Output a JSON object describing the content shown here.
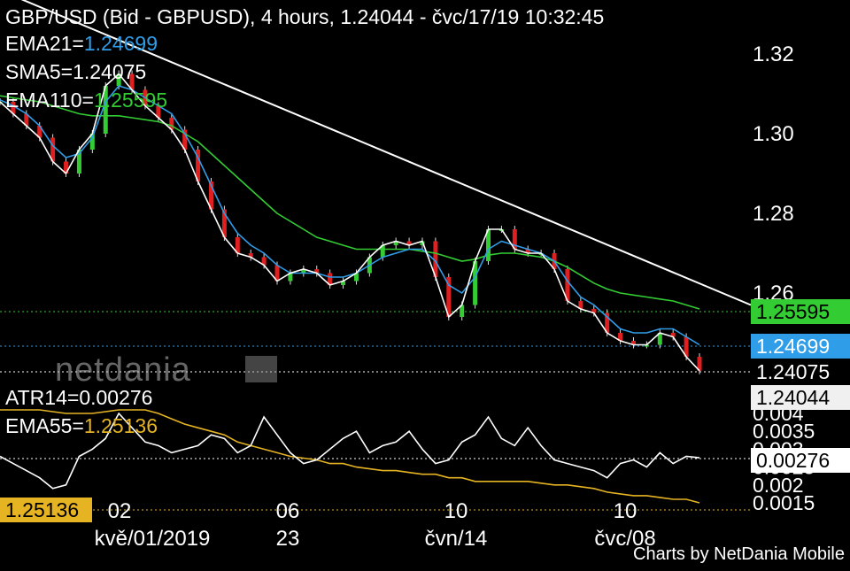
{
  "header": {
    "title": "GBP/USD (Bid - GBPUSD),  4 hours, 1.24044 - čvc/17/19 10:32:45",
    "ema21_label": "EMA21=",
    "ema21_value": "1.24699",
    "sma5_label": "SMA5=",
    "sma5_value": "1.24075",
    "ema110_label": "EMA110=",
    "ema110_value": "1.25595"
  },
  "lower_header": {
    "atr_label": "ATR14=",
    "atr_value": "0.00276",
    "ema55_label": "EMA55=",
    "ema55_value": "1.25136"
  },
  "price_tags": {
    "ema110": "1.25595",
    "ema21": "1.24699",
    "sma5": "1.24075",
    "last": "1.24044",
    "atr": "0.00276",
    "ema55": "1.25136"
  },
  "logo_text": "netdania",
  "credit": "Charts by NetDania Mobile",
  "colors": {
    "background": "#000000",
    "price": "#ffffff",
    "ema21": "#2f9de8",
    "ema110": "#33cc33",
    "sma5": "#ffffff",
    "atr": "#ffffff",
    "ema55": "#e6b422",
    "candle_up": "#33cc33",
    "candle_down": "#e02020"
  },
  "chart_data": [
    {
      "type": "line",
      "title": "GBP/USD (Bid - GBPUSD), 4 hours",
      "ylim": [
        1.2385,
        1.3335
      ],
      "y_ticks": [
        "1.32",
        "1.30",
        "1.28",
        "1.26"
      ],
      "x_ticks_day": [
        "02",
        "06",
        "10",
        "10"
      ],
      "x_ticks_date": [
        "kvě/01/2019",
        "23",
        "čvn/14",
        "čvc/08"
      ],
      "series": [
        {
          "name": "SMA5",
          "color": "#ffffff",
          "values": [
            1.308,
            1.305,
            1.302,
            1.299,
            1.293,
            1.29,
            1.296,
            1.3,
            1.312,
            1.315,
            1.311,
            1.307,
            1.304,
            1.301,
            1.296,
            1.288,
            1.281,
            1.274,
            1.27,
            1.269,
            1.267,
            1.263,
            1.265,
            1.266,
            1.265,
            1.262,
            1.263,
            1.265,
            1.269,
            1.272,
            1.273,
            1.272,
            1.273,
            1.264,
            1.254,
            1.257,
            1.268,
            1.276,
            1.276,
            1.271,
            1.27,
            1.27,
            1.266,
            1.258,
            1.256,
            1.255,
            1.25,
            1.248,
            1.247,
            1.247,
            1.25,
            1.249,
            1.244,
            1.2405
          ]
        },
        {
          "name": "EMA21",
          "color": "#2f9de8",
          "values": [
            1.3085,
            1.307,
            1.305,
            1.302,
            1.297,
            1.294,
            1.295,
            1.299,
            1.308,
            1.312,
            1.311,
            1.309,
            1.307,
            1.305,
            1.3,
            1.294,
            1.287,
            1.28,
            1.275,
            1.272,
            1.27,
            1.267,
            1.265,
            1.265,
            1.265,
            1.264,
            1.264,
            1.265,
            1.267,
            1.269,
            1.27,
            1.271,
            1.271,
            1.268,
            1.262,
            1.26,
            1.264,
            1.271,
            1.273,
            1.272,
            1.271,
            1.27,
            1.268,
            1.263,
            1.259,
            1.257,
            1.254,
            1.251,
            1.25,
            1.25,
            1.251,
            1.251,
            1.249,
            1.247
          ]
        },
        {
          "name": "EMA110",
          "color": "#33cc33",
          "values": [
            1.3095,
            1.309,
            1.3085,
            1.308,
            1.307,
            1.306,
            1.305,
            1.3045,
            1.3045,
            1.3045,
            1.304,
            1.3035,
            1.303,
            1.302,
            1.3,
            1.298,
            1.295,
            1.292,
            1.289,
            1.286,
            1.283,
            1.28,
            1.278,
            1.276,
            1.274,
            1.273,
            1.272,
            1.271,
            1.271,
            1.271,
            1.271,
            1.271,
            1.2705,
            1.27,
            1.269,
            1.268,
            1.2685,
            1.2695,
            1.27,
            1.27,
            1.2695,
            1.269,
            1.268,
            1.2665,
            1.2645,
            1.2625,
            1.261,
            1.26,
            1.2595,
            1.259,
            1.2585,
            1.258,
            1.257,
            1.256
          ]
        },
        {
          "name": "Trend line",
          "color": "#ffffff",
          "x": [
            0,
            53
          ],
          "values": [
            1.336,
            1.257
          ]
        }
      ],
      "last_price": 1.24044
    },
    {
      "type": "line",
      "title": "ATR14 / EMA55",
      "ylim": [
        0.00135,
        0.0044
      ],
      "y_ticks": [
        "0.004",
        "0.0035",
        "0.003",
        "0.0025",
        "0.002",
        "0.0015"
      ],
      "series": [
        {
          "name": "ATR14",
          "color": "#ffffff",
          "values": [
            0.0028,
            0.0026,
            0.0024,
            0.0022,
            0.0019,
            0.002,
            0.0028,
            0.003,
            0.0033,
            0.004,
            0.0036,
            0.0032,
            0.0031,
            0.0029,
            0.003,
            0.0031,
            0.0034,
            0.0033,
            0.0029,
            0.0031,
            0.0039,
            0.0034,
            0.0029,
            0.0026,
            0.0027,
            0.003,
            0.0033,
            0.0035,
            0.0029,
            0.0031,
            0.0032,
            0.0035,
            0.003,
            0.0026,
            0.0027,
            0.0032,
            0.0034,
            0.0039,
            0.0033,
            0.0031,
            0.0036,
            0.0031,
            0.0027,
            0.0026,
            0.0025,
            0.0024,
            0.0022,
            0.0026,
            0.0027,
            0.0025,
            0.0029,
            0.0026,
            0.0028,
            0.00276
          ]
        },
        {
          "name": "EMA55",
          "color": "#e6b422",
          "values": [
            0.0041,
            0.0041,
            0.0041,
            0.0041,
            0.00405,
            0.004,
            0.004,
            0.004,
            0.00405,
            0.0041,
            0.0041,
            0.0041,
            0.004,
            0.00385,
            0.0037,
            0.0036,
            0.0035,
            0.0034,
            0.0032,
            0.0031,
            0.003,
            0.0029,
            0.0028,
            0.00275,
            0.0027,
            0.0026,
            0.0026,
            0.0025,
            0.00245,
            0.0024,
            0.0024,
            0.00235,
            0.0023,
            0.0023,
            0.0022,
            0.0022,
            0.0021,
            0.0021,
            0.0021,
            0.0021,
            0.0021,
            0.00205,
            0.002,
            0.002,
            0.00195,
            0.0019,
            0.0018,
            0.00175,
            0.0017,
            0.0017,
            0.00165,
            0.0016,
            0.0016,
            0.0015
          ]
        }
      ]
    }
  ]
}
